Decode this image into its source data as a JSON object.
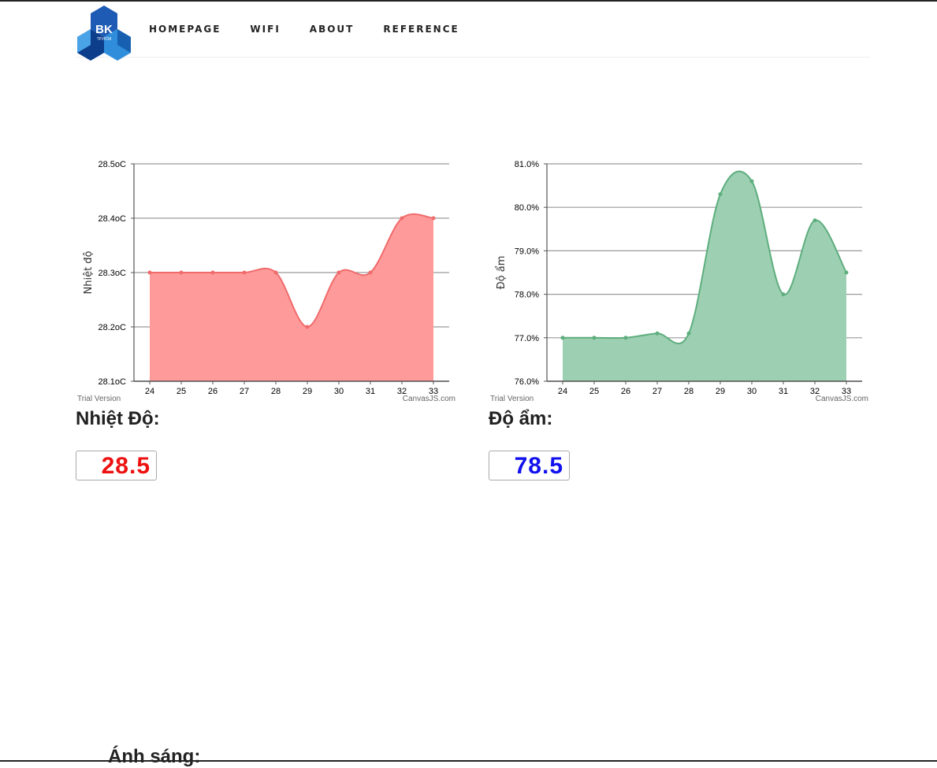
{
  "nav": {
    "logo_text": "BK",
    "logo_subtext": "TP.HCM",
    "items": [
      "HOMEPAGE",
      "WIFI",
      "ABOUT",
      "REFERENCE"
    ]
  },
  "readings": {
    "temperature": {
      "label": "Nhiệt Độ:",
      "value": "28.5",
      "color": "#ee1111"
    },
    "humidity": {
      "label": "Độ ẩm:",
      "value": "78.5",
      "color": "#1111ee"
    }
  },
  "footer": {
    "heading": "Ánh sáng:"
  },
  "chart_data": [
    {
      "type": "area",
      "ylabel": "Nhiệt độ",
      "x": [
        24,
        25,
        26,
        27,
        28,
        29,
        30,
        31,
        32,
        33
      ],
      "values": [
        28.3,
        28.3,
        28.3,
        28.3,
        28.3,
        28.2,
        28.3,
        28.3,
        28.4,
        28.4
      ],
      "ylim": [
        28.1,
        28.5
      ],
      "yticks": [
        "28.1oC",
        "28.2oC",
        "28.3oC",
        "28.4oC",
        "28.5oC"
      ],
      "grid": true,
      "line_color": "#f06b6b",
      "fill_color": "#ff9a9a",
      "credit_left": "Trial Version",
      "credit_right": "CanvasJS.com"
    },
    {
      "type": "area",
      "ylabel": "Độ ẩm",
      "x": [
        24,
        25,
        26,
        27,
        28,
        29,
        30,
        31,
        32,
        33
      ],
      "values": [
        77.0,
        77.0,
        77.0,
        77.1,
        77.1,
        80.3,
        80.6,
        78.0,
        79.7,
        78.5
      ],
      "ylim": [
        76,
        81
      ],
      "yticks": [
        "76.0%",
        "77.0%",
        "78.0%",
        "79.0%",
        "80.0%",
        "81.0%"
      ],
      "grid": true,
      "line_color": "#5eae7e",
      "fill_color": "#9dcfb2",
      "credit_left": "Trial Version",
      "credit_right": "CanvasJS.com"
    }
  ]
}
